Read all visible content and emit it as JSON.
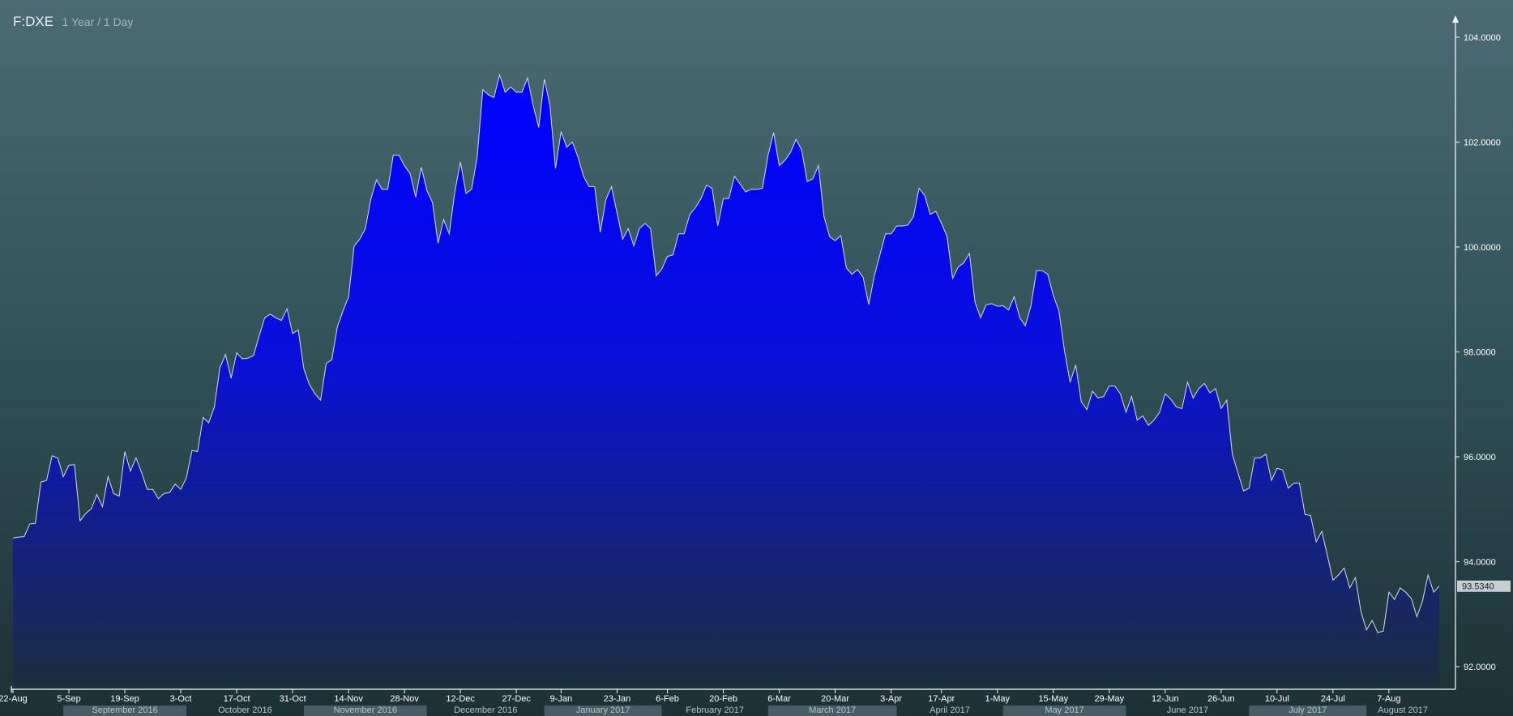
{
  "header": {
    "symbol": "F:DXE",
    "period": "1 Year / 1 Day"
  },
  "colors": {
    "fill_top": "#0000ff",
    "fill_bottom": "#1b2f3d",
    "line": "#d8dde2",
    "axis": "#ffffff",
    "label": "#ffffff",
    "month_band": "#6a8488",
    "month_text": "#b8c6c9",
    "last_price_bg": "#c8cfd2",
    "last_price_text": "#1a1a1a"
  },
  "chart_data": {
    "type": "area",
    "ylim": [
      91.6,
      104.4
    ],
    "y_ticks": [
      {
        "value": 104,
        "label": "104.0000"
      },
      {
        "value": 102,
        "label": "102.0000"
      },
      {
        "value": 100,
        "label": "100.0000"
      },
      {
        "value": 98,
        "label": "98.0000"
      },
      {
        "value": 96,
        "label": "96.0000"
      },
      {
        "value": 94,
        "label": "94.0000"
      },
      {
        "value": 92,
        "label": "92.0000"
      }
    ],
    "last_price": {
      "value": 93.534,
      "label": "93.5340"
    },
    "x_ticks": [
      {
        "index": 0,
        "label": "22-Aug"
      },
      {
        "index": 10,
        "label": "5-Sep"
      },
      {
        "index": 20,
        "label": "19-Sep"
      },
      {
        "index": 30,
        "label": "3-Oct"
      },
      {
        "index": 40,
        "label": "17-Oct"
      },
      {
        "index": 50,
        "label": "31-Oct"
      },
      {
        "index": 60,
        "label": "14-Nov"
      },
      {
        "index": 70,
        "label": "28-Nov"
      },
      {
        "index": 80,
        "label": "12-Dec"
      },
      {
        "index": 90,
        "label": "27-Dec"
      },
      {
        "index": 98,
        "label": "9-Jan"
      },
      {
        "index": 108,
        "label": "23-Jan"
      },
      {
        "index": 117,
        "label": "6-Feb"
      },
      {
        "index": 127,
        "label": "20-Feb"
      },
      {
        "index": 137,
        "label": "6-Mar"
      },
      {
        "index": 147,
        "label": "20-Mar"
      },
      {
        "index": 157,
        "label": "3-Apr"
      },
      {
        "index": 166,
        "label": "17-Apr"
      },
      {
        "index": 176,
        "label": "1-May"
      },
      {
        "index": 186,
        "label": "15-May"
      },
      {
        "index": 196,
        "label": "29-May"
      },
      {
        "index": 206,
        "label": "12-Jun"
      },
      {
        "index": 216,
        "label": "26-Jun"
      },
      {
        "index": 226,
        "label": "10-Jul"
      },
      {
        "index": 236,
        "label": "24-Jul"
      },
      {
        "index": 246,
        "label": "7-Aug"
      }
    ],
    "months": [
      {
        "start": 9,
        "end": 31,
        "label": "September 2016"
      },
      {
        "start": 31,
        "end": 52,
        "label": "October 2016"
      },
      {
        "start": 52,
        "end": 74,
        "label": "November 2016"
      },
      {
        "start": 74,
        "end": 95,
        "label": "December 2016"
      },
      {
        "start": 95,
        "end": 116,
        "label": "January 2017"
      },
      {
        "start": 116,
        "end": 135,
        "label": "February 2017"
      },
      {
        "start": 135,
        "end": 158,
        "label": "March 2017"
      },
      {
        "start": 158,
        "end": 177,
        "label": "April 2017"
      },
      {
        "start": 177,
        "end": 199,
        "label": "May 2017"
      },
      {
        "start": 199,
        "end": 221,
        "label": "June 2017"
      },
      {
        "start": 221,
        "end": 242,
        "label": "July 2017"
      },
      {
        "start": 242,
        "end": 255,
        "label": "August 2017"
      }
    ],
    "series": [
      {
        "values": [
          94.45,
          94.47,
          94.48,
          94.72,
          94.73,
          95.52,
          95.55,
          96.02,
          95.98,
          95.62,
          95.84,
          95.85,
          94.78,
          94.92,
          95.01,
          95.28,
          95.05,
          95.62,
          95.3,
          95.25,
          96.1,
          95.73,
          95.98,
          95.7,
          95.38,
          95.38,
          95.2,
          95.3,
          95.32,
          95.48,
          95.38,
          95.6,
          96.12,
          96.1,
          96.75,
          96.65,
          96.95,
          97.7,
          97.95,
          97.5,
          97.98,
          97.87,
          97.88,
          97.93,
          98.3,
          98.65,
          98.72,
          98.65,
          98.6,
          98.82,
          98.35,
          98.42,
          97.68,
          97.38,
          97.2,
          97.08,
          97.78,
          97.85,
          98.48,
          98.78,
          99.05,
          100.02,
          100.15,
          100.35,
          100.92,
          101.28,
          101.1,
          101.1,
          101.75,
          101.75,
          101.55,
          101.4,
          100.95,
          101.52,
          101.08,
          100.85,
          100.07,
          100.52,
          100.25,
          101.05,
          101.62,
          101.02,
          101.1,
          101.72,
          103.0,
          102.9,
          102.85,
          103.28,
          102.95,
          103.05,
          102.95,
          102.95,
          103.22,
          102.7,
          102.28,
          103.2,
          102.7,
          101.5,
          102.2,
          101.9,
          102.0,
          101.72,
          101.35,
          101.15,
          101.15,
          100.28,
          100.9,
          101.15,
          100.65,
          100.15,
          100.35,
          100.02,
          100.35,
          100.45,
          100.35,
          99.45,
          99.58,
          99.82,
          99.85,
          100.25,
          100.25,
          100.62,
          100.75,
          100.92,
          101.18,
          101.12,
          100.4,
          100.92,
          100.93,
          101.35,
          101.2,
          101.05,
          101.1,
          101.1,
          101.12,
          101.75,
          102.18,
          101.55,
          101.65,
          101.8,
          102.05,
          101.85,
          101.25,
          101.3,
          101.55,
          100.58,
          100.2,
          100.12,
          100.22,
          99.6,
          99.48,
          99.57,
          99.42,
          98.9,
          99.45,
          99.85,
          100.25,
          100.25,
          100.4,
          100.4,
          100.42,
          100.58,
          101.12,
          100.98,
          100.62,
          100.68,
          100.45,
          100.2,
          99.4,
          99.62,
          99.7,
          99.88,
          98.95,
          98.65,
          98.9,
          98.92,
          98.87,
          98.88,
          98.8,
          99.05,
          98.65,
          98.5,
          98.88,
          99.55,
          99.55,
          99.48,
          99.08,
          98.78,
          98.02,
          97.42,
          97.75,
          97.05,
          96.9,
          97.25,
          97.12,
          97.15,
          97.35,
          97.35,
          97.2,
          96.85,
          97.15,
          96.7,
          96.78,
          96.6,
          96.7,
          96.85,
          97.2,
          97.1,
          96.95,
          96.92,
          97.42,
          97.12,
          97.3,
          97.4,
          97.22,
          97.3,
          96.92,
          97.08,
          96.05,
          95.7,
          95.35,
          95.4,
          95.98,
          95.98,
          96.05,
          95.55,
          95.78,
          95.75,
          95.4,
          95.5,
          95.5,
          94.9,
          94.88,
          94.38,
          94.58,
          94.12,
          93.65,
          93.75,
          93.88,
          93.5,
          93.7,
          93.05,
          92.7,
          92.88,
          92.65,
          92.68,
          93.42,
          93.28,
          93.5,
          93.42,
          93.3,
          92.95,
          93.25,
          93.75,
          93.42,
          93.534
        ]
      }
    ]
  }
}
